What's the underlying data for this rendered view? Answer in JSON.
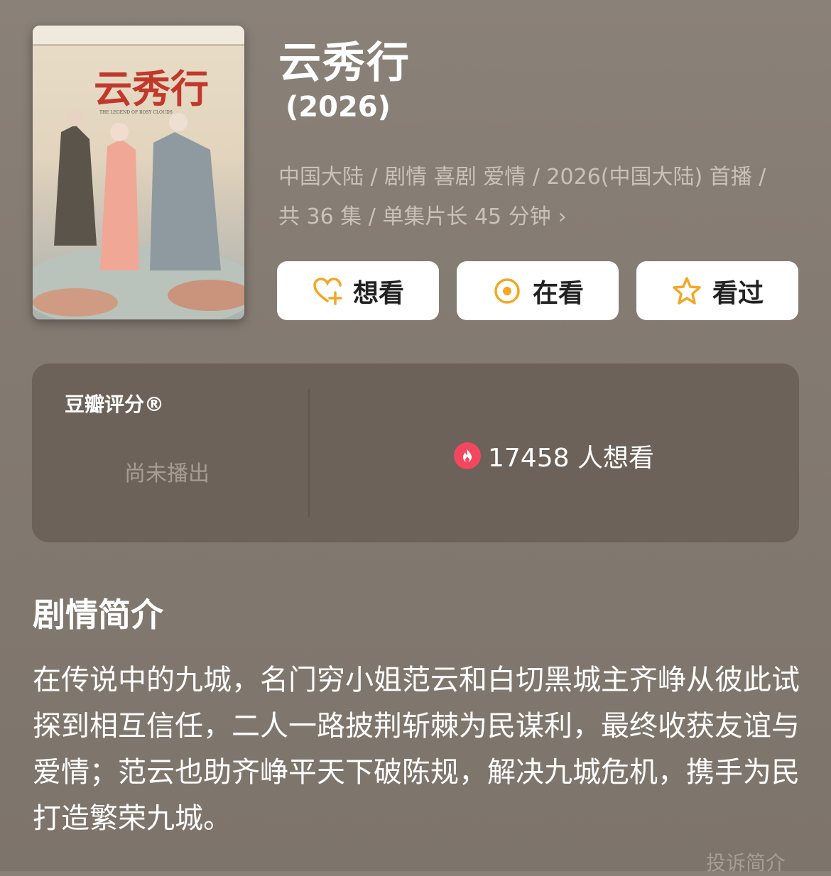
{
  "show": {
    "title": "云秀行",
    "year": "(2026)",
    "meta_line1": "中国大陆 / 剧情 喜剧 爱情 / 2026(中国大陆) 首播 /",
    "meta_line2": "共 36 集 / 单集片长 45 分钟",
    "poster": {
      "calligraphy": "云秀行",
      "english": "THE LEGEND OF ROSY CLOUDS"
    }
  },
  "actions": [
    {
      "label": "想看",
      "icon": "heart-plus-icon"
    },
    {
      "label": "在看",
      "icon": "target-icon"
    },
    {
      "label": "看过",
      "icon": "star-icon"
    }
  ],
  "rating": {
    "label": "豆瓣评分®",
    "status": "尚未播出",
    "want_count": "17458 人想看",
    "fire_icon": "fire-icon"
  },
  "synopsis": {
    "title": "剧情简介",
    "text": "在传说中的九城，名门穷小姐范云和白切黑城主齐峥从彼此试探到相互信任，二人一路披荆斩棘为民谋利，最终收获友谊与爱情；范云也助齐峥平天下破陈规，解决九城危机，携手为民打造繁荣九城。",
    "report_link": "投诉简介"
  },
  "colors": {
    "accent": "#f5a623",
    "fire": "#f2475f",
    "card": "#6c6259"
  }
}
